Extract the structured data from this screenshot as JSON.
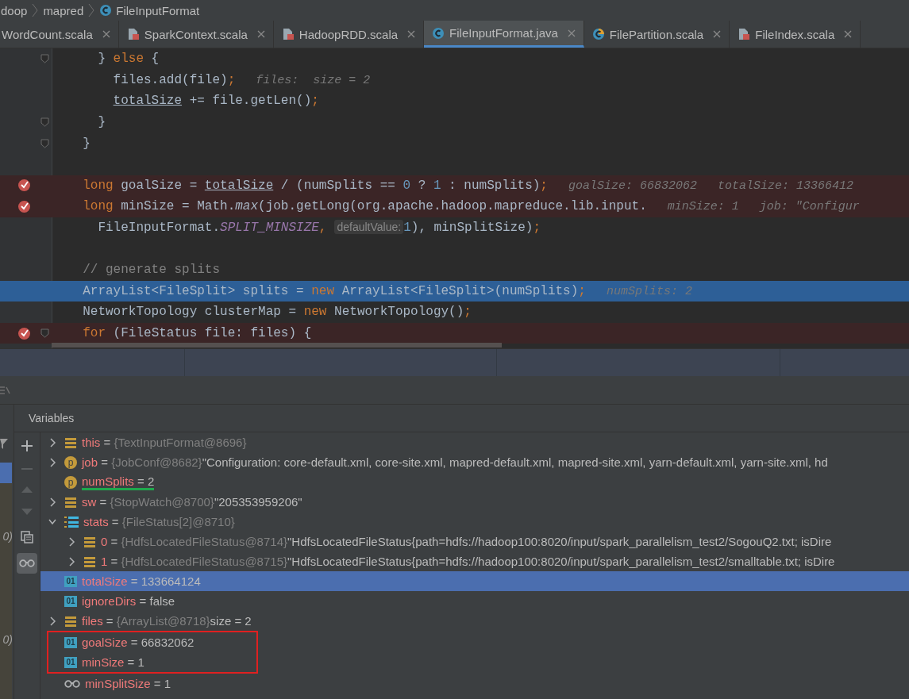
{
  "breadcrumb": [
    {
      "label": "doop"
    },
    {
      "label": "mapred"
    },
    {
      "label": "FileInputFormat",
      "kind": "class"
    }
  ],
  "tabs": [
    {
      "label": "WordCount.scala",
      "selected": false
    },
    {
      "label": "SparkContext.scala",
      "kind": "scala-file",
      "selected": false
    },
    {
      "label": "HadoopRDD.scala",
      "kind": "scala-file",
      "selected": false
    },
    {
      "label": "FileInputFormat.java",
      "kind": "class",
      "selected": true
    },
    {
      "label": "FilePartition.scala",
      "kind": "scala-class",
      "selected": false
    },
    {
      "label": "FileIndex.scala",
      "kind": "scala-file",
      "selected": false
    }
  ],
  "code_lines": [
    {
      "fold": true,
      "breakpoint": false,
      "current": false,
      "tokens": [
        {
          "kind": "text",
          "text": "    } "
        },
        {
          "kind": "kw",
          "text": "else"
        },
        {
          "kind": "text",
          "text": " {"
        }
      ]
    },
    {
      "fold": false,
      "breakpoint": false,
      "current": false,
      "tokens": [
        {
          "kind": "text",
          "text": "      files.add(file)"
        },
        {
          "kind": "kw",
          "text": ";"
        },
        {
          "kind": "hint",
          "text": "files:  size = 2"
        }
      ]
    },
    {
      "fold": false,
      "breakpoint": false,
      "current": false,
      "tokens": [
        {
          "kind": "ref",
          "text": "      totalSize"
        },
        {
          "kind": "text",
          "text": " += file.getLen()"
        },
        {
          "kind": "kw",
          "text": ";"
        }
      ]
    },
    {
      "fold": true,
      "breakpoint": false,
      "current": false,
      "tokens": [
        {
          "kind": "text",
          "text": "    }"
        }
      ]
    },
    {
      "fold": true,
      "breakpoint": false,
      "current": false,
      "tokens": [
        {
          "kind": "text",
          "text": "  }"
        }
      ]
    },
    {
      "fold": false,
      "breakpoint": false,
      "current": false
    },
    {
      "fold": false,
      "breakpoint": true,
      "current": false,
      "tokens": [
        {
          "kind": "kw",
          "text": "  long"
        },
        {
          "kind": "text",
          "text": " goalSize = "
        },
        {
          "kind": "ref",
          "text": "totalSize"
        },
        {
          "kind": "text",
          "text": " / (numSplits == "
        },
        {
          "kind": "num",
          "text": "0"
        },
        {
          "kind": "text",
          "text": " ? "
        },
        {
          "kind": "num",
          "text": "1"
        },
        {
          "kind": "text",
          "text": " : numSplits)"
        },
        {
          "kind": "kw",
          "text": ";"
        },
        {
          "kind": "hint",
          "text": "goalSize: 66832062"
        },
        {
          "kind": "hint",
          "text": "totalSize: 13366412"
        }
      ]
    },
    {
      "fold": false,
      "breakpoint": true,
      "current": false,
      "tokens": [
        {
          "kind": "kw",
          "text": "  long"
        },
        {
          "kind": "text",
          "text": " minSize = Math."
        },
        {
          "kind": "italic",
          "text": "max"
        },
        {
          "kind": "text",
          "text": "(job.getLong(org.apache.hadoop.mapreduce.lib.input."
        },
        {
          "kind": "hint",
          "text": "minSize: 1"
        },
        {
          "kind": "hint",
          "text": "job: \"Configur"
        }
      ]
    },
    {
      "fold": false,
      "breakpoint": false,
      "current": false,
      "tokens": [
        {
          "kind": "text",
          "text": "    FileInputFormat."
        },
        {
          "kind": "const",
          "text": "SPLIT_MINSIZE"
        },
        {
          "kind": "kw",
          "text": ","
        },
        {
          "kind": "param",
          "text": "defaultValue:"
        },
        {
          "kind": "num",
          "text": "1"
        },
        {
          "kind": "text",
          "text": "), minSplitSize)"
        },
        {
          "kind": "kw",
          "text": ";"
        }
      ]
    },
    {
      "fold": false,
      "breakpoint": false,
      "current": false
    },
    {
      "fold": false,
      "breakpoint": false,
      "current": false,
      "tokens": [
        {
          "kind": "comment",
          "text": "  // generate splits"
        }
      ]
    },
    {
      "fold": false,
      "breakpoint": false,
      "current": true,
      "tokens": [
        {
          "kind": "text",
          "text": "  ArrayList<FileSplit> splits = "
        },
        {
          "kind": "kw",
          "text": "new"
        },
        {
          "kind": "text",
          "text": " ArrayList<FileSplit>(numSplits)"
        },
        {
          "kind": "kw",
          "text": ";"
        },
        {
          "kind": "hint",
          "text": "numSplits: 2"
        }
      ]
    },
    {
      "fold": false,
      "breakpoint": false,
      "current": false,
      "tokens": [
        {
          "kind": "text",
          "text": "  NetworkTopology clusterMap = "
        },
        {
          "kind": "kw",
          "text": "new"
        },
        {
          "kind": "text",
          "text": " NetworkTopology()"
        },
        {
          "kind": "kw",
          "text": ";"
        }
      ]
    },
    {
      "fold": true,
      "breakpoint": true,
      "current": false,
      "tokens": [
        {
          "kind": "kw",
          "text": "  for"
        },
        {
          "kind": "text",
          "text": " (FileStatus file: files) {"
        }
      ]
    }
  ],
  "frames_panel": {
    "texts": [
      "0)",
      "0)"
    ]
  },
  "variables": {
    "title": "Variables",
    "rows": [
      {
        "icon": {
          "kind": "field"
        },
        "name": "this",
        "op": "=",
        "ref": "{TextInputFormat@8696}",
        "expanded": false,
        "selected": false
      },
      {
        "icon": {
          "kind": "param",
          "text": "p"
        },
        "name": "job",
        "op": "=",
        "ref": "{JobConf@8682}",
        "value": "\"Configuration: core-default.xml, core-site.xml, mapred-default.xml, mapred-site.xml, yarn-default.xml, yarn-site.xml, hd",
        "expanded": false,
        "selected": false
      },
      {
        "icon": {
          "kind": "param",
          "text": "p"
        },
        "name": "numSplits",
        "op": "=",
        "value": "2",
        "selected": false,
        "underlined": true
      },
      {
        "icon": {
          "kind": "field"
        },
        "name": "sw",
        "op": "=",
        "ref": "{StopWatch@8700}",
        "value": "\"205353959206\"",
        "expanded": false,
        "selected": false
      },
      {
        "icon": {
          "kind": "array"
        },
        "name": "stats",
        "op": "=",
        "ref": "{FileStatus[2]@8710}",
        "expanded": true,
        "selected": false,
        "children": [
          {
            "icon": {
              "kind": "field"
            },
            "name": "0",
            "op": "=",
            "ref": "{HdfsLocatedFileStatus@8714}",
            "value": "\"HdfsLocatedFileStatus{path=hdfs://hadoop100:8020/input/spark_parallelism_test2/SogouQ2.txt; isDire",
            "expanded": false,
            "selected": false
          },
          {
            "icon": {
              "kind": "field"
            },
            "name": "1",
            "op": "=",
            "ref": "{HdfsLocatedFileStatus@8715}",
            "value": "\"HdfsLocatedFileStatus{path=hdfs://hadoop100:8020/input/spark_parallelism_test2/smalltable.txt; isDire",
            "expanded": false,
            "selected": false
          }
        ]
      },
      {
        "icon": {
          "kind": "int",
          "text": "01"
        },
        "name": "totalSize",
        "op": "=",
        "value": "133664124",
        "selected": true
      },
      {
        "icon": {
          "kind": "int",
          "text": "01"
        },
        "name": "ignoreDirs",
        "op": "=",
        "value": "false",
        "selected": false
      },
      {
        "icon": {
          "kind": "field"
        },
        "name": "files",
        "op": "=",
        "ref": "{ArrayList@8718}",
        "value": "size = 2",
        "expanded": false,
        "selected": false
      },
      {
        "icon": {
          "kind": "int",
          "text": "01"
        },
        "name": "goalSize",
        "op": "=",
        "value": "66832062",
        "selected": false,
        "boxed": true
      },
      {
        "icon": {
          "kind": "int",
          "text": "01"
        },
        "name": "minSize",
        "op": "=",
        "value": "1",
        "selected": false,
        "boxed": true
      },
      {
        "icon": {
          "kind": "watch"
        },
        "name": "minSplitSize",
        "op": "=",
        "value": "1",
        "selected": false
      }
    ]
  }
}
